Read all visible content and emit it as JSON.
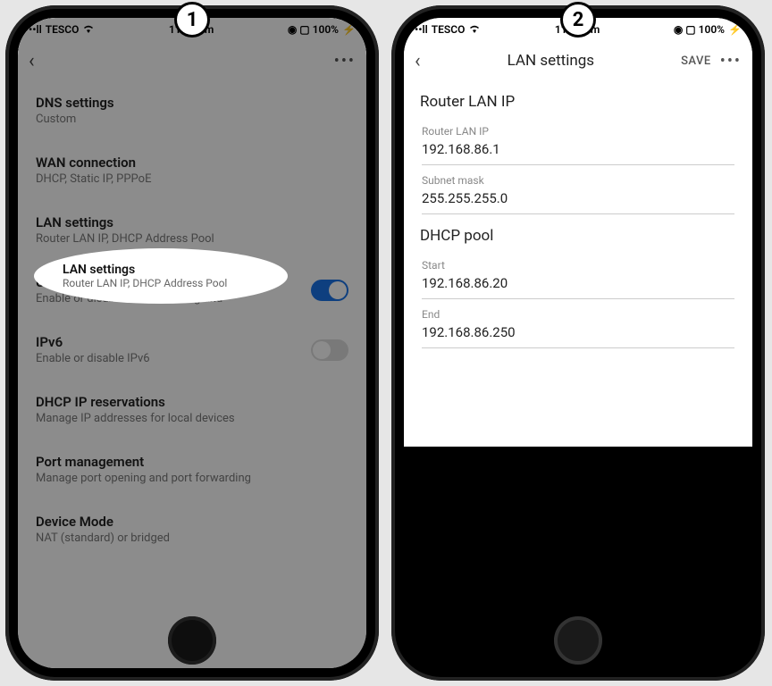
{
  "status": {
    "signal": "••ll",
    "carrier": "TESCO",
    "wifi": "📶",
    "time": "11:42 am",
    "icons_right": "◉ ▢ 100%",
    "battery": "⚡"
  },
  "badges": {
    "one": "1",
    "two": "2"
  },
  "screen1": {
    "back": "‹",
    "more": "•••",
    "items": [
      {
        "title": "DNS settings",
        "sub": "Custom"
      },
      {
        "title": "WAN connection",
        "sub": "DHCP, Static IP, PPPoE"
      },
      {
        "title": "LAN settings",
        "sub": "Router LAN IP, DHCP Address Pool"
      },
      {
        "title": "UPnP",
        "sub": "Enable or disable Universal Plug and",
        "toggle": true
      },
      {
        "title": "IPv6",
        "sub": "Enable or disable IPv6",
        "toggle": false
      },
      {
        "title": "DHCP IP reservations",
        "sub": "Manage IP addresses for local devices"
      },
      {
        "title": "Port management",
        "sub": "Manage port opening and port forwarding"
      },
      {
        "title": "Device Mode",
        "sub": "NAT (standard) or bridged"
      }
    ]
  },
  "screen2": {
    "back": "‹",
    "title": "LAN settings",
    "save": "SAVE",
    "more": "•••",
    "section1": "Router LAN IP",
    "fields1": [
      {
        "label": "Router LAN IP",
        "value": "192.168.86.1"
      },
      {
        "label": "Subnet mask",
        "value": "255.255.255.0"
      }
    ],
    "section2": "DHCP pool",
    "fields2": [
      {
        "label": "Start",
        "value": "192.168.86.20"
      },
      {
        "label": "End",
        "value": "192.168.86.250"
      }
    ]
  }
}
